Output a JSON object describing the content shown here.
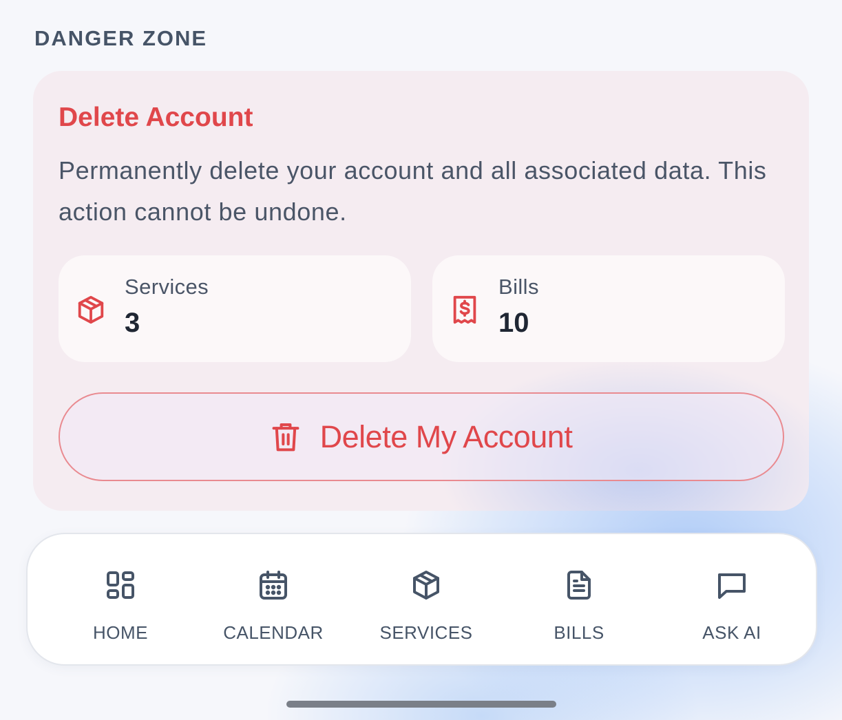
{
  "section": {
    "title": "DANGER ZONE"
  },
  "card": {
    "heading": "Delete Account",
    "description": "Permanently delete your account and all associated data. This action cannot be undone.",
    "stats": {
      "services": {
        "label": "Services",
        "value": "3",
        "icon": "package-icon"
      },
      "bills": {
        "label": "Bills",
        "value": "10",
        "icon": "receipt-icon"
      }
    },
    "delete_button": {
      "label": "Delete My Account",
      "icon": "trash-icon"
    }
  },
  "nav": {
    "items": [
      {
        "label": "HOME",
        "icon": "grid-icon"
      },
      {
        "label": "CALENDAR",
        "icon": "calendar-icon"
      },
      {
        "label": "SERVICES",
        "icon": "package-icon"
      },
      {
        "label": "BILLS",
        "icon": "document-icon"
      },
      {
        "label": "ASK AI",
        "icon": "chat-icon"
      }
    ]
  },
  "colors": {
    "danger": "#e0474b",
    "text_muted": "#4a5567",
    "card_background": "#f5ecf1",
    "nav_icon": "#465467"
  }
}
